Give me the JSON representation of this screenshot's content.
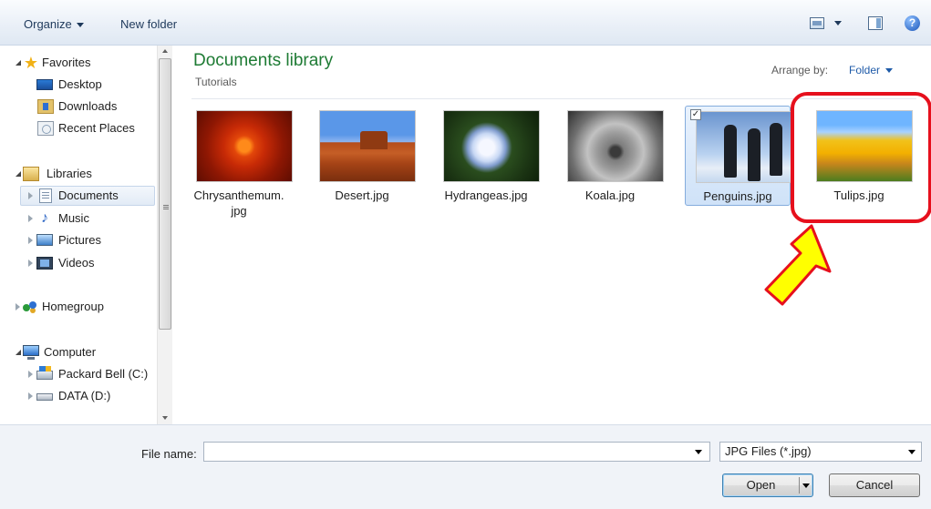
{
  "toolbar": {
    "organize_label": "Organize",
    "new_folder_label": "New folder"
  },
  "nav": {
    "favorites": {
      "label": "Favorites",
      "items": [
        {
          "label": "Desktop",
          "icon": "desktop-icon"
        },
        {
          "label": "Downloads",
          "icon": "downloads-icon"
        },
        {
          "label": "Recent Places",
          "icon": "recent-places-icon"
        }
      ]
    },
    "libraries": {
      "label": "Libraries",
      "items": [
        {
          "label": "Documents",
          "icon": "documents-icon",
          "selected": true
        },
        {
          "label": "Music",
          "icon": "music-icon"
        },
        {
          "label": "Pictures",
          "icon": "pictures-icon"
        },
        {
          "label": "Videos",
          "icon": "videos-icon"
        }
      ]
    },
    "homegroup": {
      "label": "Homegroup"
    },
    "computer": {
      "label": "Computer",
      "items": [
        {
          "label": "Packard Bell (C:)",
          "icon": "drive-c-icon"
        },
        {
          "label": "DATA (D:)",
          "icon": "drive-d-icon"
        }
      ]
    }
  },
  "content": {
    "title": "Documents library",
    "subtitle": "Tutorials",
    "arrange_label": "Arrange by:",
    "arrange_value": "Folder",
    "files": [
      {
        "name": "Chrysanthemum.",
        "name_line2": "jpg",
        "selected": false
      },
      {
        "name": "Desert.jpg",
        "selected": false
      },
      {
        "name": "Hydrangeas.jpg",
        "selected": false
      },
      {
        "name": "Koala.jpg",
        "selected": false
      },
      {
        "name": "Penguins.jpg",
        "selected": true
      },
      {
        "name": "Tulips.jpg",
        "selected": false
      }
    ]
  },
  "bottom": {
    "file_name_label": "File name:",
    "file_name_value": "",
    "filter_value": "JPG Files (*.jpg)",
    "open_label": "Open",
    "cancel_label": "Cancel"
  },
  "colors": {
    "accent": "#1e7b34",
    "link": "#1e5aa8",
    "highlight_ring": "#e6101d",
    "arrow_fill": "#ffff00"
  }
}
